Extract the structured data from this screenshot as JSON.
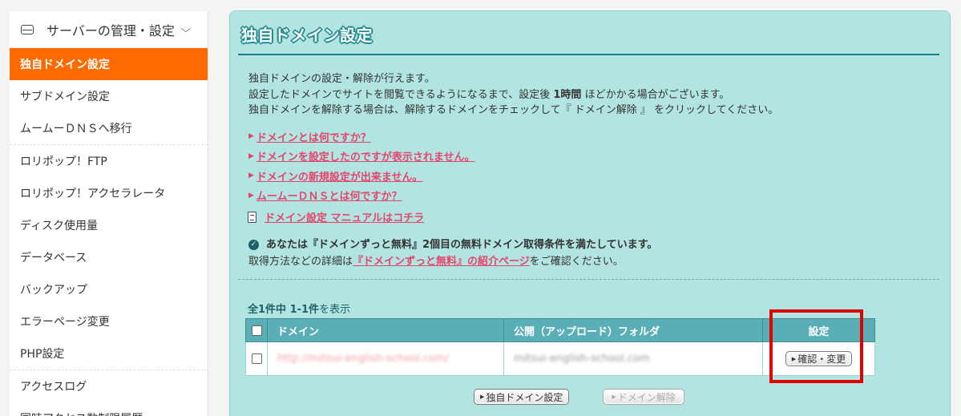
{
  "sidebar": {
    "header": "サーバーの管理・設定",
    "items": [
      "独自ドメイン設定",
      "サブドメイン設定",
      "ムームーＤＮＳへ移行",
      "ロリポップ！FTP",
      "ロリポップ！アクセラレータ",
      "ディスク使用量",
      "データベース",
      "バックアップ",
      "エラーページ変更",
      "PHP設定",
      "アクセスログ",
      "同時アクセス数制限履歴"
    ]
  },
  "panel": {
    "title": "独自ドメイン設定",
    "desc": {
      "line1": "独自ドメインの設定・解除が行えます。",
      "line2_pre": "設定したドメインでサイトを閲覧できるようになるまで、設定後",
      "line2_bold": "1時間",
      "line2_post": "ほどかかる場合がございます。",
      "line3": "独自ドメインを解除する場合は、解除するドメインをチェックして『 ドメイン解除 』 をクリックしてください。"
    },
    "links": [
      "ドメインとは何ですか？",
      "ドメインを設定したのですが表示されません。",
      "ドメインの新規設定が出来ません。",
      "ムームーＤＮＳとは何ですか？"
    ],
    "manual_link": "ドメイン設定 マニュアルはコチラ",
    "notice": {
      "line1": "あなたは『ドメインずっと無料』2個目の無料ドメイン取得条件を満たしています。",
      "line2_pre": "取得方法などの詳細は",
      "line2_link": "『ドメインずっと無料』の紹介ページ",
      "line2_post": "をご確認ください。"
    },
    "count": {
      "bold": "全1件中 1-1件",
      "rest": "を表示"
    },
    "table": {
      "headers": [
        "ドメイン",
        "公開（アップロード）フォルダ",
        "設定"
      ],
      "rows": [
        {
          "domain": "http://mitsui-english-school.com/",
          "folder": "mitsui-english-school.com",
          "action": "確認・変更"
        }
      ]
    },
    "buttons": {
      "set_domain": "独自ドメイン設定",
      "remove_domain": "ドメイン解除"
    }
  },
  "colors": {
    "accent_orange": "#ff6a00",
    "panel_bg": "#b2e5e1",
    "link_pink": "#e4456c",
    "table_header": "#5aafb6",
    "highlight_red": "#e00000"
  }
}
